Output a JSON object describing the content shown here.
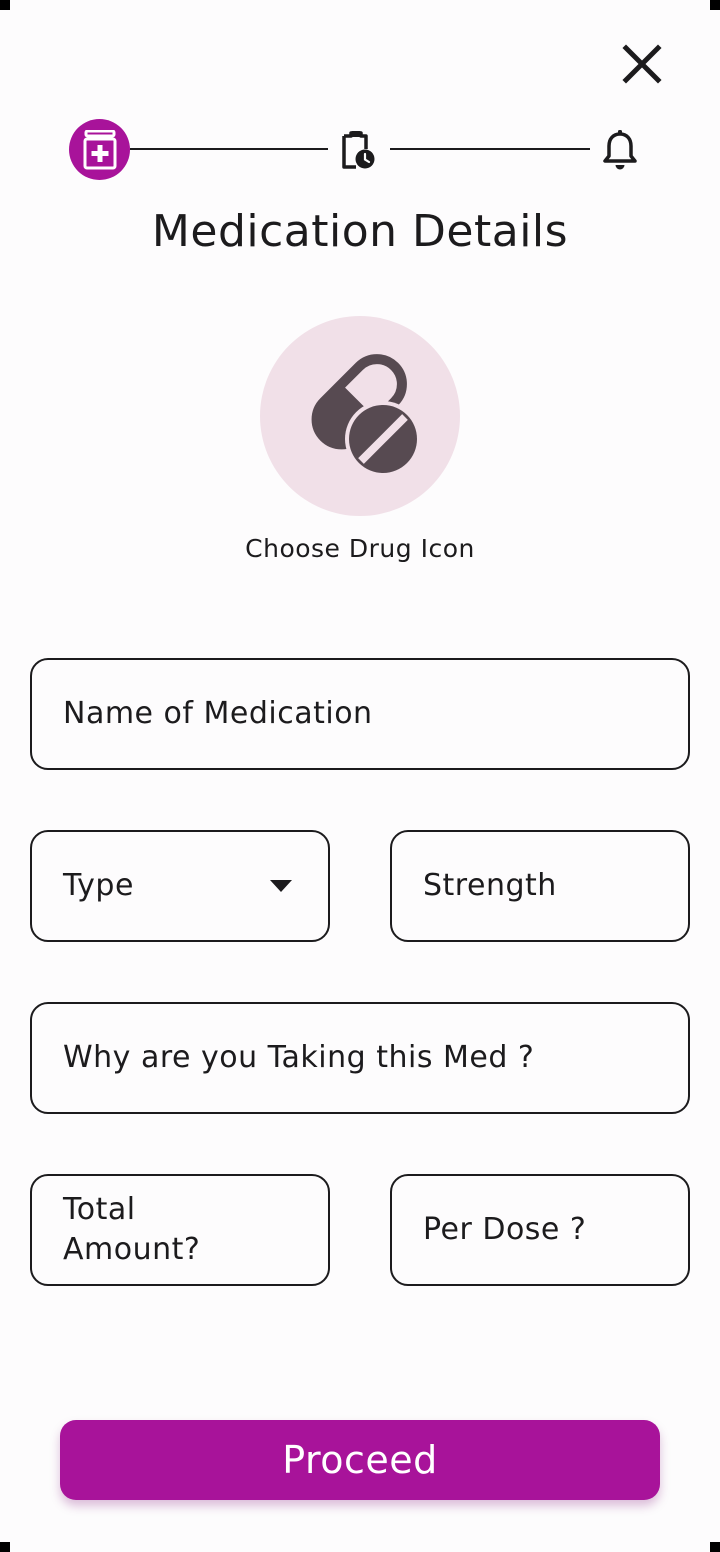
{
  "header": {
    "close_icon": "close-icon"
  },
  "stepper": {
    "steps": [
      {
        "icon": "medication-add-icon",
        "active": true
      },
      {
        "icon": "clipboard-clock-icon",
        "active": false
      },
      {
        "icon": "bell-icon",
        "active": false
      }
    ],
    "active_color": "#a8139a"
  },
  "page": {
    "title": "Medication Details"
  },
  "drug_icon": {
    "icon": "pills-icon",
    "label": "Choose Drug Icon",
    "background": "#f1e0e8"
  },
  "form": {
    "name": {
      "placeholder": "Name of Medication"
    },
    "type": {
      "placeholder": "Type"
    },
    "strength": {
      "placeholder": "Strength"
    },
    "reason": {
      "placeholder": "Why are you Taking this Med ?"
    },
    "total_amount": {
      "placeholder": "Total Amount?"
    },
    "per_dose": {
      "placeholder": "Per Dose ?"
    }
  },
  "actions": {
    "proceed_label": "Proceed",
    "accent": "#a8139a"
  }
}
